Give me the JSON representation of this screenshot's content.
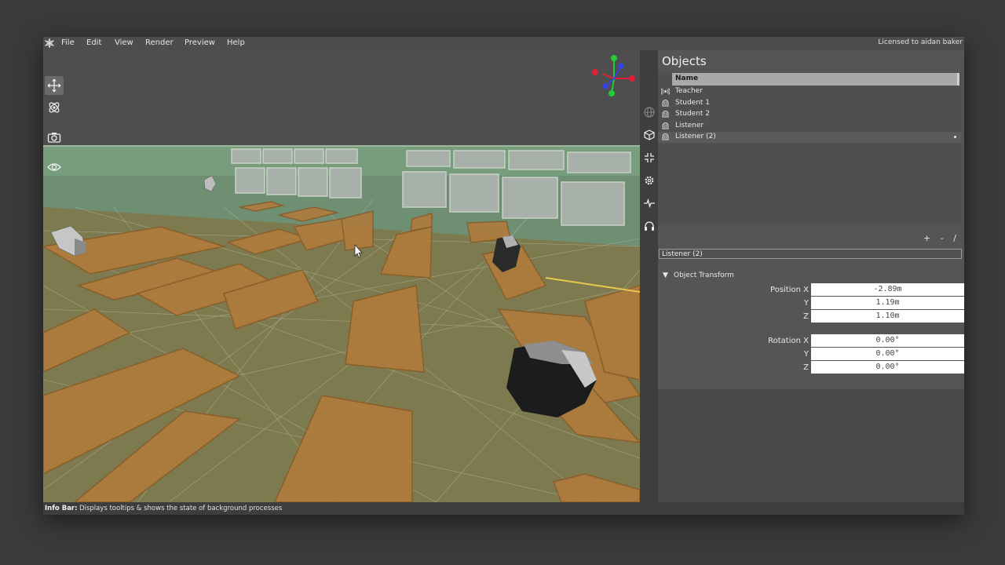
{
  "menubar": {
    "items": [
      "File",
      "Edit",
      "View",
      "Render",
      "Preview",
      "Help"
    ],
    "license": "Licensed to aidan baker"
  },
  "viewport": {
    "tools": [
      "move-tool-icon",
      "orbit-tool-icon",
      "camera-icon",
      "eye-icon"
    ],
    "gizmo_colors": {
      "x": "#e0203a",
      "y": "#22cc33",
      "z": "#3344ee"
    }
  },
  "side_icons": [
    "globe-icon",
    "cube-icon",
    "compress-icon",
    "gear-icon",
    "pulse-icon",
    "headphones-icon"
  ],
  "panel": {
    "title": "Objects",
    "column_header": "Name",
    "objects": [
      {
        "label": "Teacher",
        "icon": "speaker-icon"
      },
      {
        "label": "Student 1",
        "icon": "head-icon"
      },
      {
        "label": "Student 2",
        "icon": "head-icon"
      },
      {
        "label": "Listener",
        "icon": "head-icon"
      },
      {
        "label": "Listener (2)",
        "icon": "head-icon"
      }
    ],
    "buttons": {
      "add": "+",
      "remove": "-",
      "edit": "/"
    },
    "selected_name": "Listener (2)",
    "section_title": "Object Transform",
    "position": {
      "label": "Position X",
      "y_label": "Y",
      "z_label": "Z",
      "x": "-2.89m",
      "y": "1.19m",
      "z": "1.10m"
    },
    "rotation": {
      "label": "Rotation X",
      "y_label": "Y",
      "z_label": "Z",
      "x": "0.00°",
      "y": "0.00°",
      "z": "0.00°"
    }
  },
  "infobar": {
    "label": "Info Bar:",
    "text": "Displays tooltips & shows the state of background processes"
  }
}
